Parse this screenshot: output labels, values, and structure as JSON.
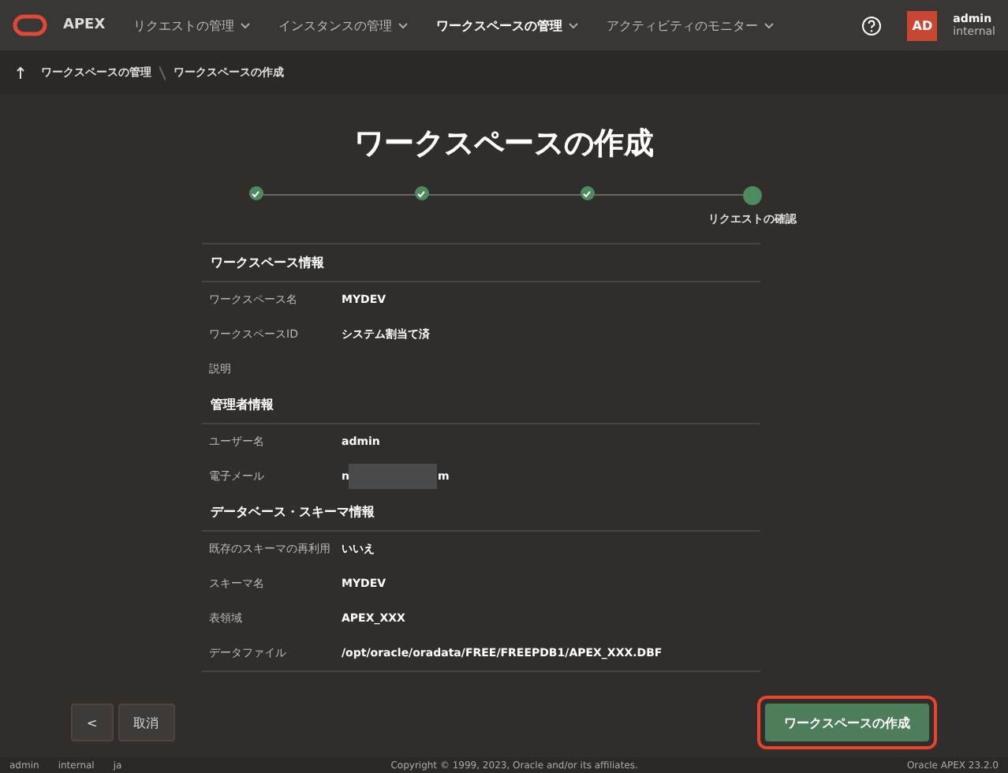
{
  "header": {
    "app_name": "APEX",
    "nav": [
      {
        "label": "リクエストの管理",
        "selected": false
      },
      {
        "label": "インスタンスの管理",
        "selected": false
      },
      {
        "label": "ワークスペースの管理",
        "selected": true
      },
      {
        "label": "アクティビティのモニター",
        "selected": false
      }
    ],
    "user": {
      "initials": "AD",
      "name": "admin",
      "workspace": "internal"
    }
  },
  "breadcrumb": [
    "ワークスペースの管理",
    "ワークスペースの作成"
  ],
  "title": "ワークスペースの作成",
  "steps": [
    {
      "done": true
    },
    {
      "done": true
    },
    {
      "done": true
    },
    {
      "done": false,
      "label": "リクエストの確認"
    }
  ],
  "sections": [
    {
      "heading": "ワークスペース情報",
      "rows": [
        {
          "label": "ワークスペース名",
          "value": "MYDEV"
        },
        {
          "label": "ワークスペースID",
          "value": "システム割当て済"
        },
        {
          "label": "説明"
        }
      ]
    },
    {
      "heading": "管理者情報",
      "rows": [
        {
          "label": "ユーザー名",
          "value": "admin"
        },
        {
          "label": "電子メール",
          "value": "n",
          "redacted": true,
          "value_end": "m"
        }
      ]
    },
    {
      "heading": "データベース・スキーマ情報",
      "rows": [
        {
          "label": "既存のスキーマの再利用",
          "value": "いいえ"
        },
        {
          "label": "スキーマ名",
          "value": "MYDEV"
        },
        {
          "label": "表領域",
          "value": "APEX_XXX"
        },
        {
          "label": "データファイル",
          "value": "/opt/oracle/oradata/FREE/FREEPDB1/APEX_XXX.DBF"
        }
      ]
    }
  ],
  "buttons": {
    "back": "<",
    "cancel": "取消",
    "create": {
      "label": "ワークスペースの作成",
      "highlighted": true
    }
  },
  "footer": {
    "user": "admin",
    "workspace": "internal",
    "language": "ja",
    "copyright": "Copyright © 1999, 2023, Oracle and/or its affiliates.",
    "version": "Oracle APEX 23.2.0"
  }
}
